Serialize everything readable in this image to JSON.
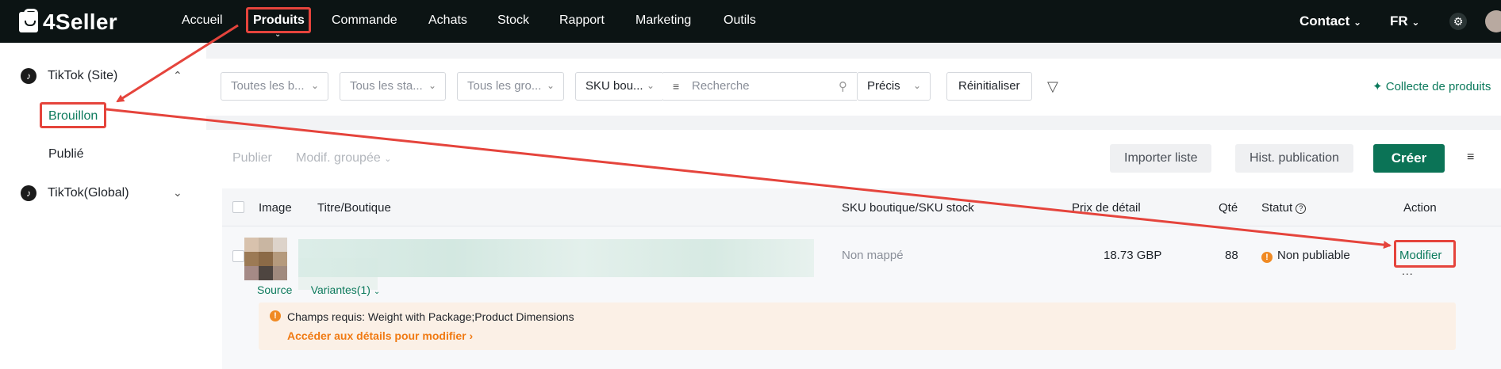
{
  "topbar": {
    "logo_text": "4Seller",
    "nav": [
      "Accueil",
      "Produits",
      "Commande",
      "Achats",
      "Stock",
      "Rapport",
      "Marketing",
      "Outils"
    ],
    "active_nav": "Produits",
    "contact": "Contact",
    "lang": "FR"
  },
  "sidebar": {
    "group1": "TikTok (Site)",
    "item_brouillon": "Brouillon",
    "item_publie": "Publié",
    "group2": "TikTok(Global)"
  },
  "filters": {
    "brand": "Toutes les b...",
    "status": "Tous les sta...",
    "group": "Tous les gro...",
    "sku_type": "SKU bou...",
    "search_placeholder": "Recherche",
    "match": "Précis",
    "reset": "Réinitialiser",
    "collect": "Collecte de produits"
  },
  "toolbar": {
    "publish": "Publier",
    "bulk_edit": "Modif. groupée",
    "import": "Importer liste",
    "history": "Hist. publication",
    "create": "Créer"
  },
  "table": {
    "headers": {
      "image": "Image",
      "title": "Titre/Boutique",
      "sku": "SKU boutique/SKU stock",
      "price": "Prix de détail",
      "qty": "Qté",
      "status": "Statut",
      "action": "Action"
    },
    "row": {
      "sku": "Non mappé",
      "price": "18.73 GBP",
      "qty": "88",
      "status": "Non publiable",
      "action": "Modifier",
      "more": "...",
      "source": "Source",
      "variants": "Variantes(1)",
      "notice": "Champs requis: Weight with Package;Product Dimensions",
      "notice_link": "Accéder aux détails pour modifier"
    }
  },
  "colors": {
    "brand_green": "#0b7356",
    "annotation_red": "#e5443c",
    "warning_orange": "#f08a24"
  }
}
